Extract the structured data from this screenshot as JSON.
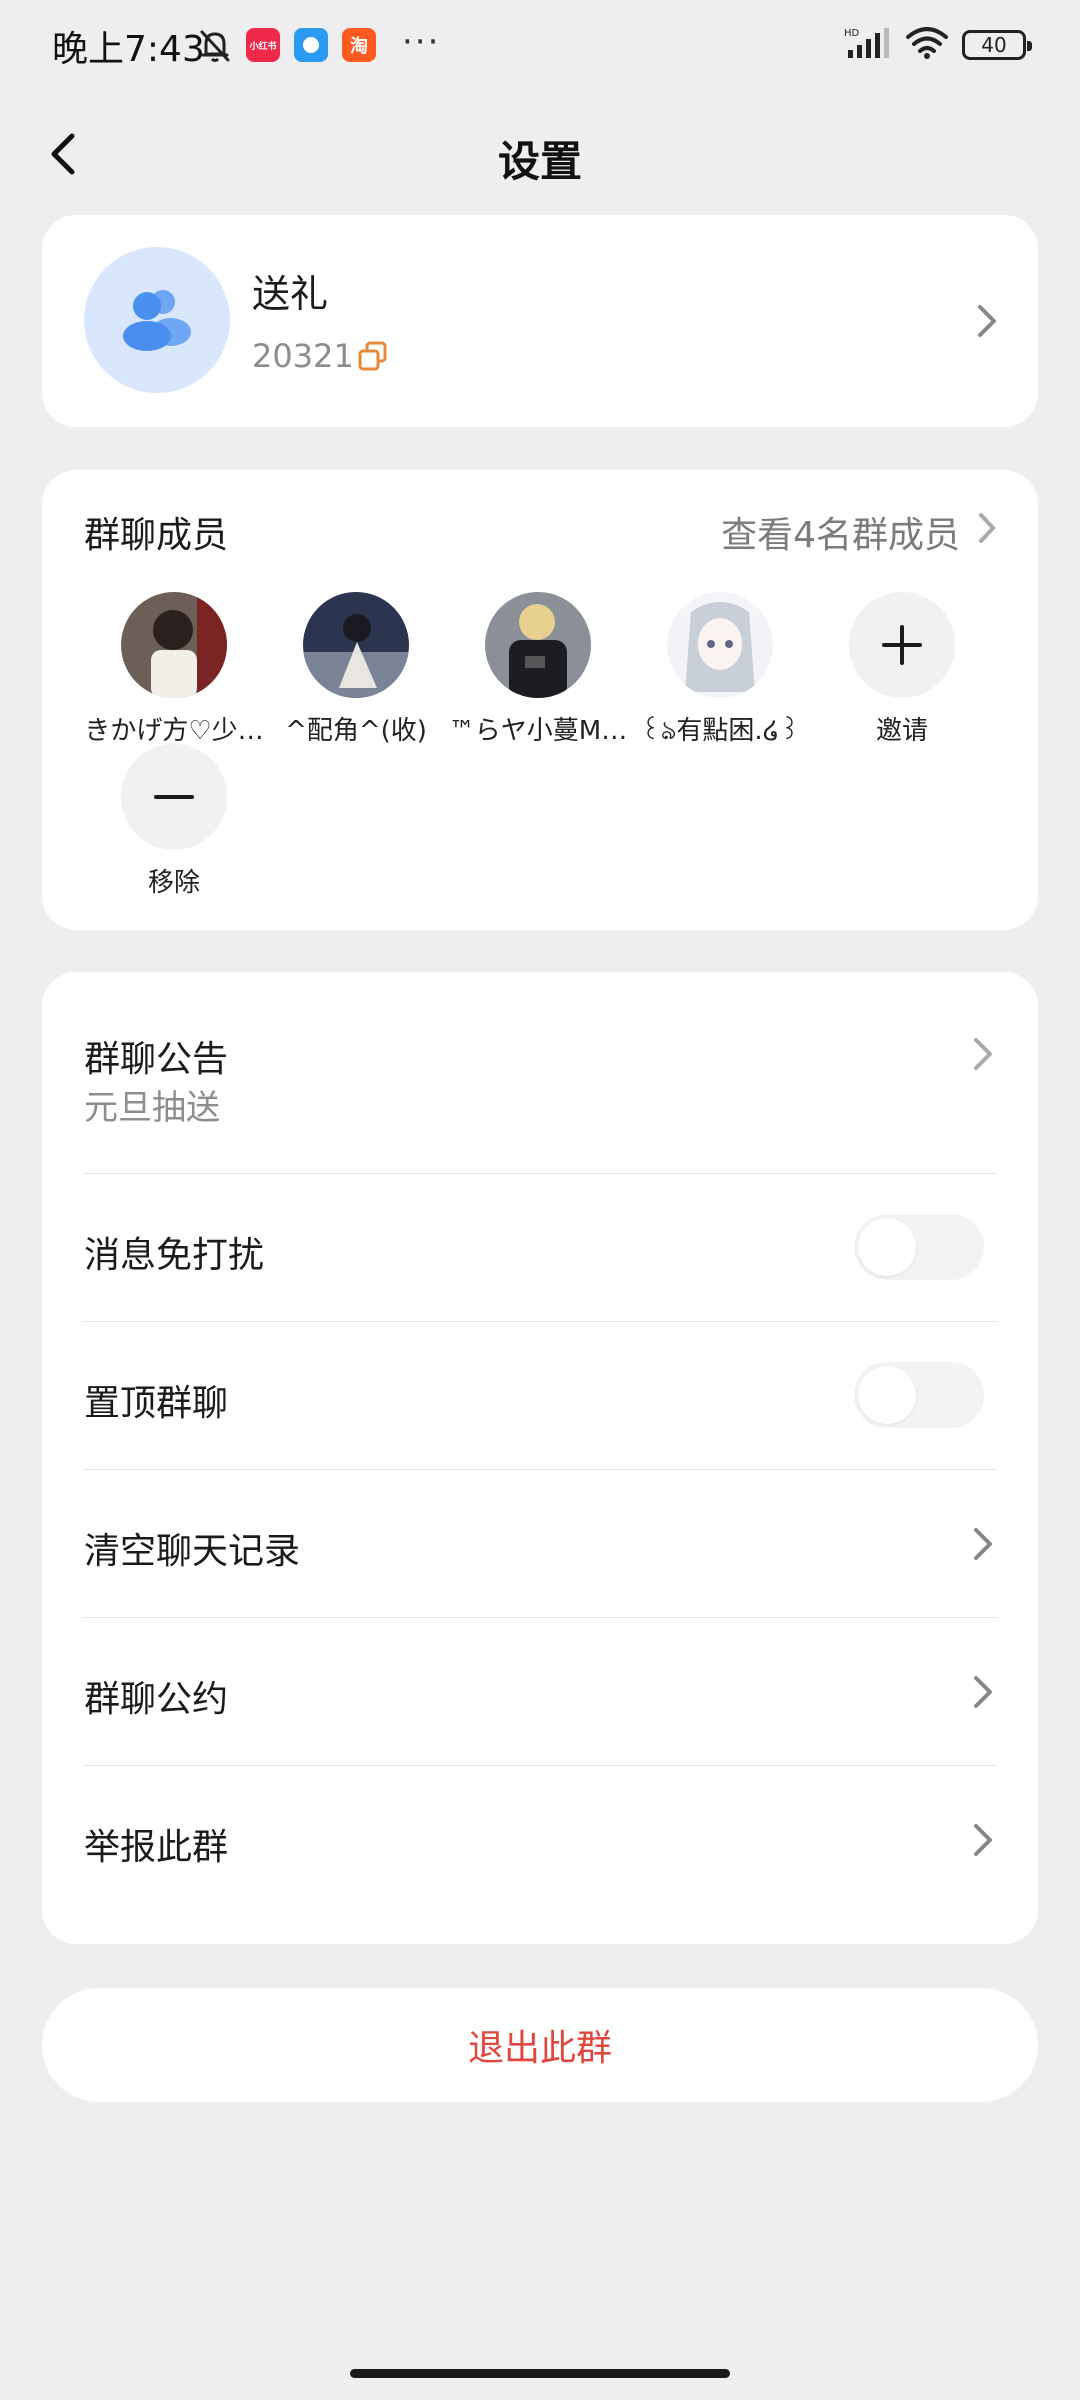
{
  "status_bar": {
    "time": "晚上7:43",
    "apps": [
      {
        "label": "小红书",
        "color": "#f0284a"
      },
      {
        "label": "",
        "color": "#2a9af3"
      },
      {
        "label": "淘",
        "color": "#ff5a1f"
      }
    ],
    "more": "···",
    "network": "HD",
    "battery": "40"
  },
  "header": {
    "title": "设置"
  },
  "group": {
    "name": "送礼",
    "id": "20321"
  },
  "members": {
    "title": "群聊成员",
    "view_all": "查看4名群成员",
    "list": [
      {
        "name": "きかげ方♡少…",
        "bg": "#6d5e58"
      },
      {
        "name": "^配角^(收)",
        "bg": "#4a5570"
      },
      {
        "name": "™らヤ小蔓M…",
        "bg": "#2f3138"
      },
      {
        "name": "꒰ঌ有點困.໒꒱",
        "bg": "#c9cfd8"
      }
    ],
    "invite_label": "邀请",
    "remove_label": "移除"
  },
  "settings": {
    "announcement": {
      "label": "群聊公告",
      "value": "元旦抽送"
    },
    "mute": {
      "label": "消息免打扰",
      "on": false
    },
    "pin": {
      "label": "置顶群聊",
      "on": false
    },
    "clear": {
      "label": "清空聊天记录"
    },
    "rules": {
      "label": "群聊公约"
    },
    "report": {
      "label": "举报此群"
    }
  },
  "exit_label": "退出此群",
  "colors": {
    "background": "#eeedf0",
    "card": "#ffffff",
    "accent_blue": "#4a8ff0",
    "danger": "#e0483f",
    "copy_icon": "#e8883a"
  }
}
